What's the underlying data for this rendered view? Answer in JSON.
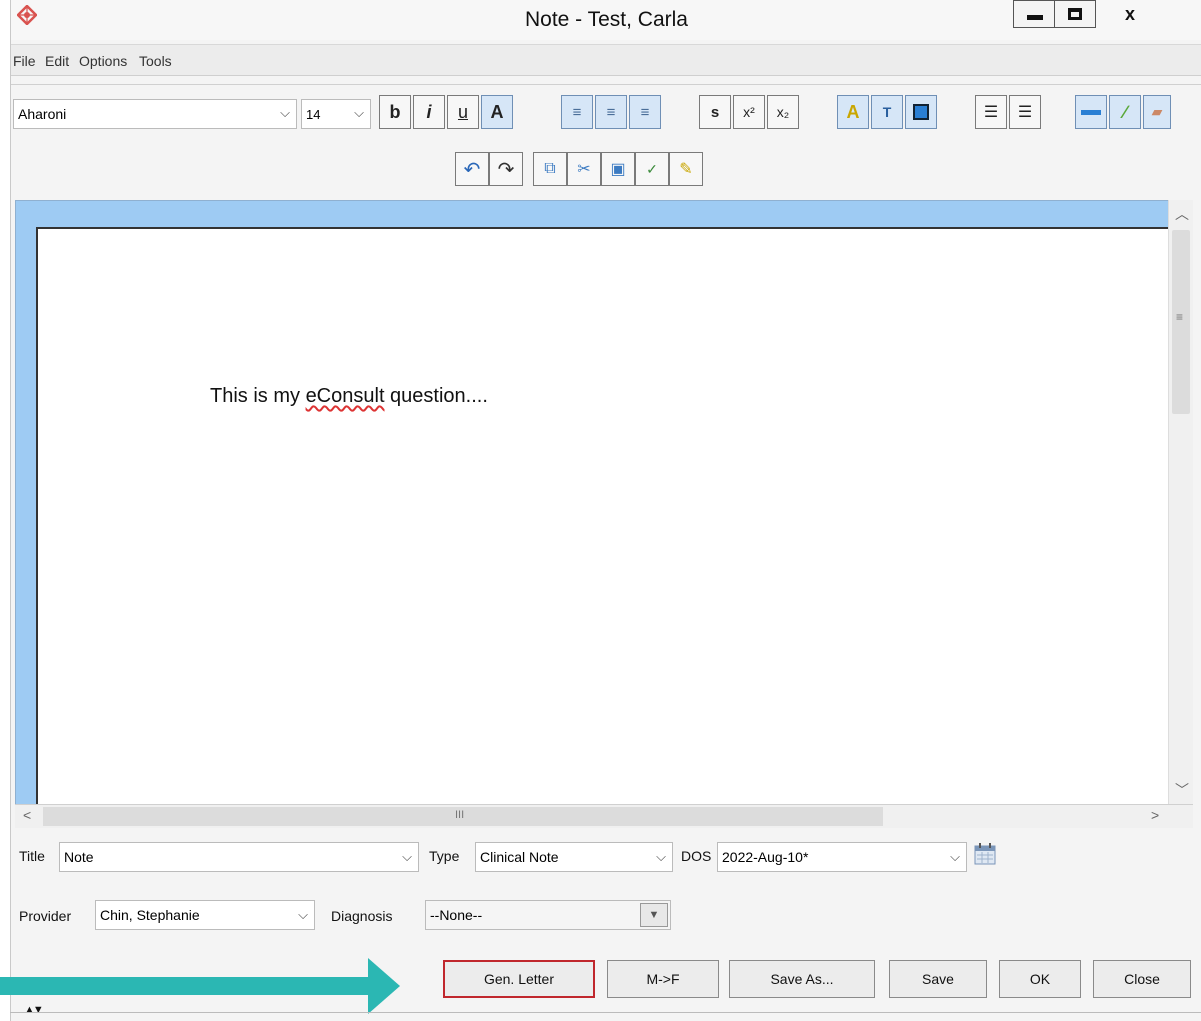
{
  "window": {
    "title": "Note - Test, Carla",
    "close_label": "x"
  },
  "menu": {
    "items": [
      {
        "label": "File"
      },
      {
        "label": "Edit"
      },
      {
        "label": "Options"
      },
      {
        "label": "Tools"
      }
    ]
  },
  "toolbar": {
    "font": "Aharoni",
    "size": "14",
    "bold": "b",
    "italic": "i",
    "underline": "u",
    "font_color": "A",
    "strike": "s",
    "superscript": "x²",
    "subscript": "x₂",
    "highlight": "A",
    "textbox": "T"
  },
  "editor": {
    "content": "This is my eConsult question....",
    "content_before": "This is my ",
    "content_misspelled": "eConsult",
    "content_after": " question....",
    "hscroll_mark": "III"
  },
  "form": {
    "title_label": "Title",
    "title_value": "Note",
    "type_label": "Type",
    "type_value": "Clinical Note",
    "dos_label": "DOS",
    "dos_value": "2022-Aug-10*",
    "provider_label": "Provider",
    "provider_value": "Chin, Stephanie",
    "diagnosis_label": "Diagnosis",
    "diagnosis_value": "--None--"
  },
  "buttons": {
    "gen_letter": "Gen. Letter",
    "m_to_f": "M->F",
    "save_as": "Save As...",
    "save": "Save",
    "ok": "OK",
    "close": "Close"
  },
  "colors": {
    "highlight_border": "#c0272d",
    "arrow": "#2bb7b3",
    "editor_frame": "#9ecbf3"
  }
}
